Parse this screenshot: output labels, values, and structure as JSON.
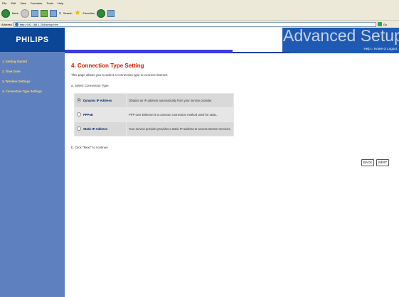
{
  "browser": {
    "menu": [
      "File",
      "Edit",
      "View",
      "Favorites",
      "Tools",
      "Help"
    ],
    "toolbar": {
      "back": "Back",
      "search": "Search",
      "favorites": "Favorites"
    },
    "address_label": "Address",
    "address": "http://192.168.1.254/setup.htm",
    "go_label": "Go"
  },
  "app": {
    "logo": "PHILIPS",
    "brand": "Advanced Setup",
    "help_links": "Help  ⌂ Home  ⊙ Logout"
  },
  "sidebar": {
    "items": [
      {
        "label": "1. Getting Started"
      },
      {
        "label": "2. Time Zone"
      },
      {
        "label": "3. Wireless Settings"
      },
      {
        "label": "4. Connection Type Settings"
      }
    ]
  },
  "page": {
    "title": "4. Connection Type Setting",
    "description": "This page allows you to select a connection type to connect internet.",
    "step_a": "a. Select Connection Type:",
    "step_b": "b. Click \"Next\" to continue",
    "options": [
      {
        "label": "Dynamic IP Address",
        "desc": "Obtains an IP address automatically from your service provider.",
        "selected": true
      },
      {
        "label": "PPPoE",
        "desc": "PPP over Ethernet is a common connection method used for xDSL.",
        "selected": false
      },
      {
        "label": "Static IP Address",
        "desc": "Your service provider provides a static IP address to access Internet services.",
        "selected": false
      }
    ],
    "back_button": "BACK",
    "next_button": "NEXT"
  }
}
